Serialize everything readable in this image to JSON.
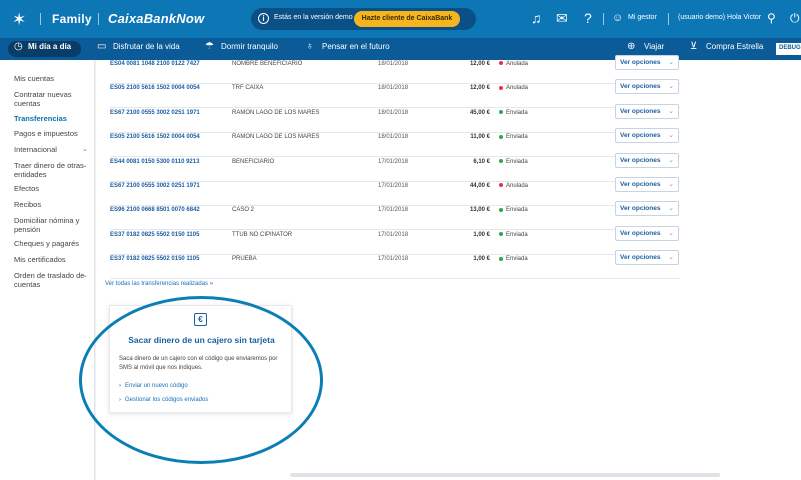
{
  "topbar": {
    "brand_star_icon": "caixabank-star-icon",
    "family": "Family",
    "brand": "CaixaBankNow",
    "demo_text": "Estás en la versión demo",
    "demo_button": "Hazte cliente de CaixaBank",
    "manager": "Mi gestor",
    "user": "(usuario demo) Hola Victor"
  },
  "nav": {
    "items": [
      "Mi día a día",
      "Disfrutar de la vida",
      "Dormir tranquilo",
      "Pensar en el futuro"
    ],
    "right_items": [
      "Viajar",
      "Compra Estrella"
    ],
    "debug": "DEBUG"
  },
  "sidebar": {
    "items": [
      "Mis cuentas",
      "Contratar nuevas cuentas",
      "Transferencias",
      "Pagos e impuestos",
      "Internacional",
      "Traer dinero de otras entidades",
      "Efectos",
      "Recibos",
      "Domiciliar nómina y pensión",
      "Cheques y pagarés",
      "Mis certificados",
      "Orden de traslado de cuentas"
    ],
    "active_index": 2
  },
  "transfers": {
    "rows": [
      {
        "iban": "ES04 0081 1048 2100 0122 7427",
        "name": "NOMBRE BENEFICIARIO",
        "date": "18/01/2018",
        "amount": "12,00 €",
        "status": "Anulada"
      },
      {
        "iban": "ES05 2100 5616 1502 0004 0054",
        "name": "TRF CAIXA",
        "date": "18/01/2018",
        "amount": "12,00 €",
        "status": "Anulada"
      },
      {
        "iban": "ES67 2100 0555 3002 0251 1971",
        "name": "RAMON LAGO DE LOS MARES",
        "date": "18/01/2018",
        "amount": "45,00 €",
        "status": "Enviada"
      },
      {
        "iban": "ES05 2100 5616 1502 0004 0054",
        "name": "RAMON LAGO DE LOS MARES",
        "date": "18/01/2018",
        "amount": "11,00 €",
        "status": "Enviada"
      },
      {
        "iban": "ES44 0081 0150 5300 0110 9213",
        "name": "BENEFICIARIO",
        "date": "17/01/2018",
        "amount": "6,10 €",
        "status": "Enviada"
      },
      {
        "iban": "ES67 2100 0555 3002 0251 1971",
        "name": "",
        "date": "17/01/2018",
        "amount": "44,00 €",
        "status": "Anulada"
      },
      {
        "iban": "ES96 2100 0668 8501 0070 6842",
        "name": "Caso 2",
        "date": "17/01/2018",
        "amount": "13,00 €",
        "status": "Enviada"
      },
      {
        "iban": "ES37 0182 0825 5502 0150 1105",
        "name": "TTUB NO CIPINATOR",
        "date": "17/01/2018",
        "amount": "1,00 €",
        "status": "Enviada"
      },
      {
        "iban": "ES37 0182 0825 5502 0150 1105",
        "name": "PRUEBA",
        "date": "17/01/2018",
        "amount": "1,00 €",
        "status": "Enviada"
      }
    ],
    "options_label": "Ver opciones",
    "see_all": "Ver todas las transferencias realizadas",
    "status_colors": {
      "Anulada": "#e0374b",
      "Enviada": "#2fa84f"
    }
  },
  "card": {
    "title": "Sacar dinero de un cajero sin tarjeta",
    "description": "Saca dinero de un cajero con el código que enviaremos por SMS al móvil que nos indiques.",
    "links": [
      "Enviar un nuevo código",
      "Gestionar los códigos enviados"
    ],
    "icon": "euro-card-icon"
  },
  "colors": {
    "primary": "#0d77b6",
    "nav": "#0b5b98",
    "accent": "#f6b51e",
    "highlight_ring": "#0b7fb4"
  }
}
